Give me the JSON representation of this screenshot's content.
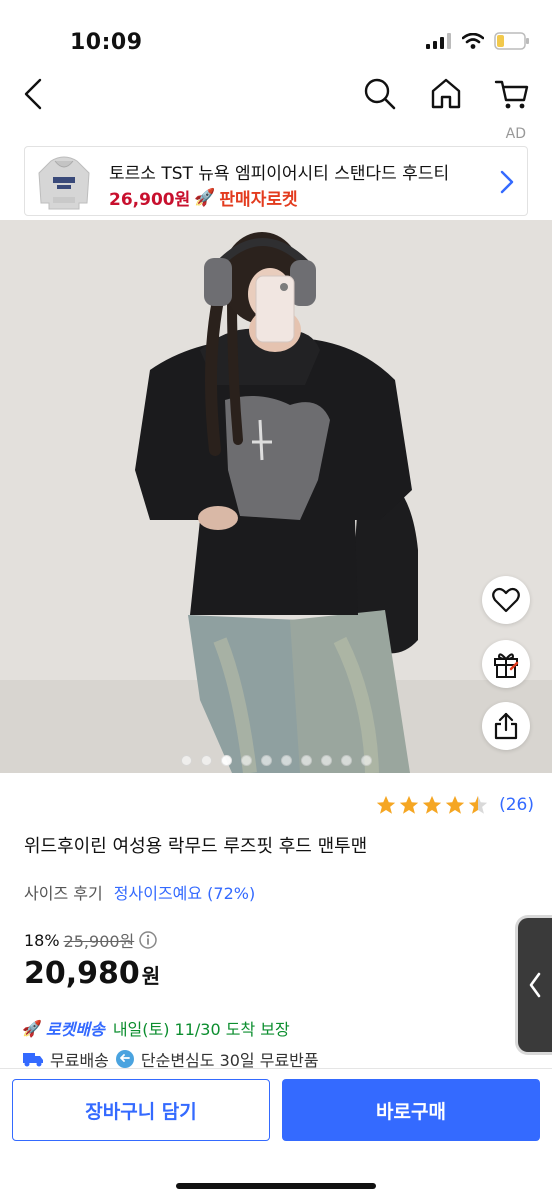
{
  "status_bar": {
    "time": "10:09"
  },
  "nav": {
    "icons": [
      "back-icon",
      "search-icon",
      "home-icon",
      "cart-icon"
    ]
  },
  "ad": {
    "label": "AD",
    "title": "토르소 TST 뉴욕 엠피이어시티 스탠다드 후드티",
    "price": "26,900원",
    "badge": "판매자로켓"
  },
  "gallery": {
    "total": 10,
    "active": 3
  },
  "floating_actions": [
    "heart-icon",
    "gift-icon",
    "share-icon"
  ],
  "product": {
    "rating": 4.5,
    "review_count": "(26)",
    "title": "위드후이린 여성용 락무드 루즈핏 후드 맨투맨",
    "size_review_label": "사이즈 후기",
    "size_review_value": "정사이즈예요 (72%)",
    "discount_rate": "18%",
    "original_price": "25,900원",
    "final_price": "20,980",
    "final_unit": "원",
    "rocket_label": "로켓배송",
    "delivery_date": "내일(토) 11/30 도착 보장",
    "shipping_free": "무료배송",
    "return_policy": "단순변심도 30일 무료반품"
  },
  "buttons": {
    "cart": "장바구니 담기",
    "buy": "바로구매"
  },
  "colors": {
    "accent": "#346aff",
    "price_red": "#c8102e",
    "delivery_green": "#0c8e2f",
    "star": "#f5a623"
  }
}
